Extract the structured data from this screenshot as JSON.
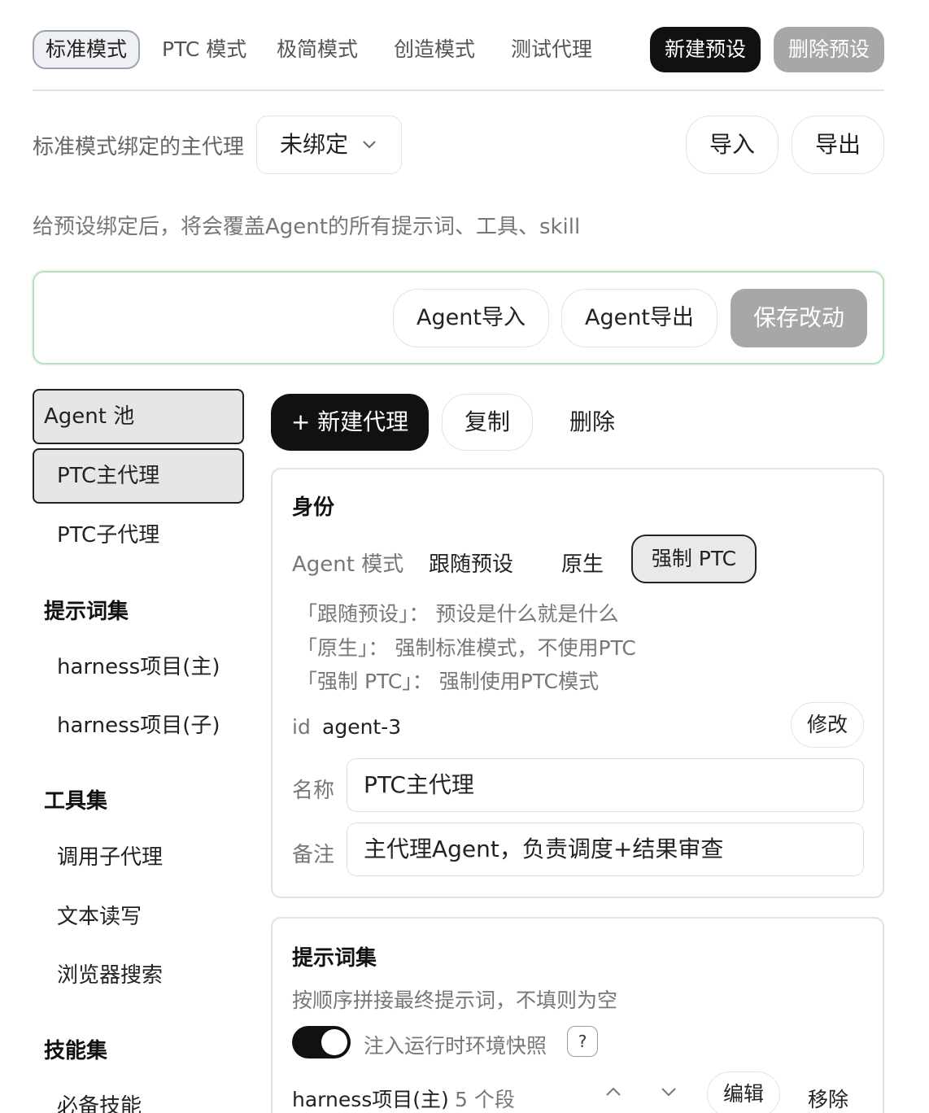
{
  "top_tabs": [
    {
      "label": "标准模式",
      "active": true
    },
    {
      "label": "PTC 模式",
      "active": false
    },
    {
      "label": "极简模式",
      "active": false
    },
    {
      "label": "创造模式",
      "active": false
    },
    {
      "label": "测试代理",
      "active": false
    }
  ],
  "top_actions": {
    "new_preset": "新建预设",
    "delete_preset": "删除预设"
  },
  "binding": {
    "label": "标准模式绑定的主代理",
    "selected": "未绑定",
    "import_label": "导入",
    "export_label": "导出",
    "hint": "给预设绑定后，将会覆盖Agent的所有提示词、工具、skill"
  },
  "agent_box": {
    "import_label": "Agent导入",
    "export_label": "Agent导出",
    "save_label": "保存改动"
  },
  "sidebar": {
    "agent_pool": "Agent 池",
    "agents": [
      "PTC主代理",
      "PTC子代理"
    ],
    "prompt_head": "提示词集",
    "prompts": [
      "harness项目(主)",
      "harness项目(子)"
    ],
    "tool_head": "工具集",
    "tools": [
      "调用子代理",
      "文本读写",
      "浏览器搜索"
    ],
    "skill_head": "技能集",
    "skills": [
      "必备技能"
    ]
  },
  "actions": {
    "new_agent": "+ 新建代理",
    "copy": "复制",
    "delete": "删除"
  },
  "identity": {
    "title": "身份",
    "mode_label": "Agent 模式",
    "modes": [
      "跟随预设",
      "原生",
      "强制 PTC"
    ],
    "selected_mode": "强制 PTC",
    "desc": [
      "「跟随预设」：  预设是什么就是什么",
      "「原生」：  强制标准模式，不使用PTC",
      "「强制 PTC」：  强制使用PTC模式"
    ],
    "id_label": "id",
    "id_value": "agent-3",
    "edit_label": "修改",
    "name_label": "名称",
    "name_value": "PTC主代理",
    "note_label": "备注",
    "note_value": "主代理Agent，负责调度+结果审查"
  },
  "prompt_panel": {
    "title": "提示词集",
    "desc": "按顺序拼接最终提示词，不填则为空",
    "toggle_label": "注入运行时环境快照",
    "toggle_on": true,
    "help": "?",
    "item_name": "harness项目(主)",
    "item_count": "5 个段",
    "edit_label": "编辑",
    "remove_label": "移除"
  }
}
